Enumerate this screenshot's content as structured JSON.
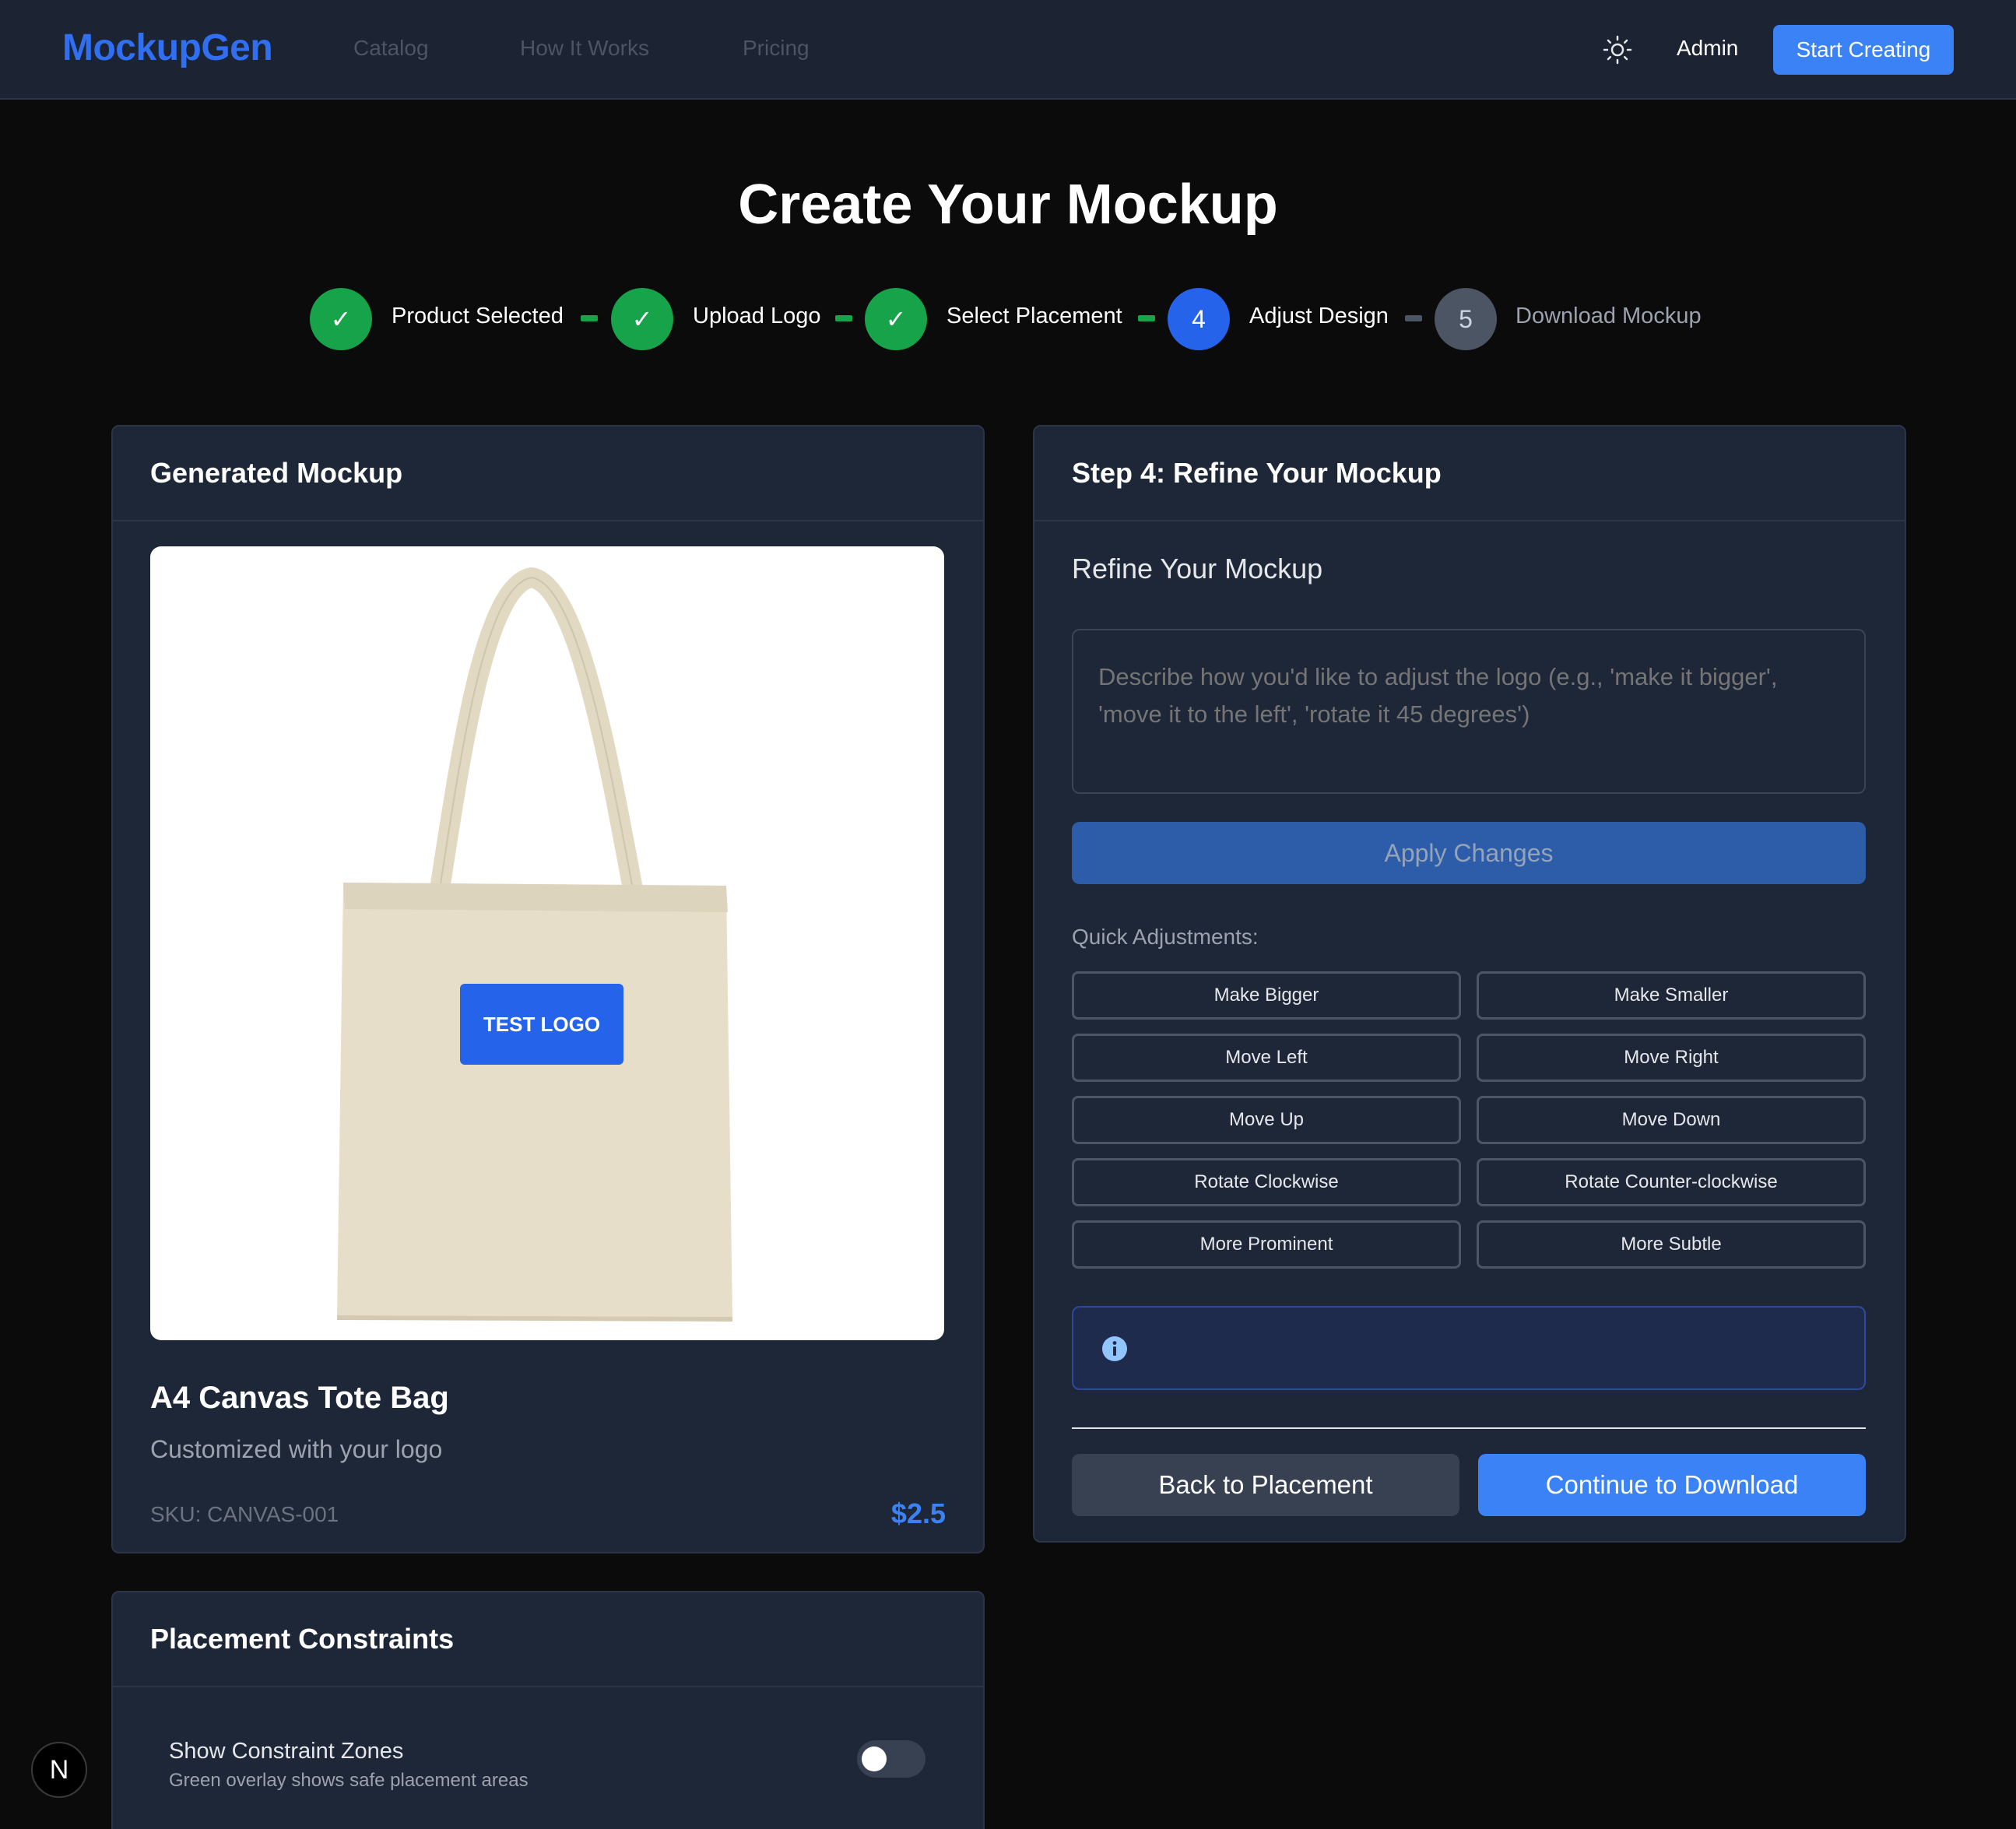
{
  "nav": {
    "brand": "MockupGen",
    "links": [
      "Catalog",
      "How It Works",
      "Pricing"
    ],
    "theme_icon": "sun-icon",
    "admin": "Admin",
    "cta": "Start Creating"
  },
  "page_title": "Create Your Mockup",
  "steps": [
    {
      "label": "Product Selected",
      "marker": "✓",
      "state": "done"
    },
    {
      "label": "Upload Logo",
      "marker": "✓",
      "state": "done"
    },
    {
      "label": "Select Placement",
      "marker": "✓",
      "state": "done"
    },
    {
      "label": "Adjust Design",
      "marker": "4",
      "state": "active"
    },
    {
      "label": "Download Mockup",
      "marker": "5",
      "state": "pending"
    }
  ],
  "mockup_card": {
    "title": "Generated Mockup",
    "logo_text": "TEST LOGO",
    "product_name": "A4 Canvas Tote Bag",
    "subtitle": "Customized with your logo",
    "sku": "SKU: CANVAS-001",
    "price": "$2.5"
  },
  "refine_card": {
    "title": "Step 4: Refine Your Mockup",
    "section_title": "Refine Your Mockup",
    "placeholder": "Describe how you'd like to adjust the logo (e.g., 'make it bigger', 'move it to the left', 'rotate it 45 degrees')",
    "apply": "Apply Changes",
    "quick_label": "Quick Adjustments:",
    "quick": [
      "Make Bigger",
      "Make Smaller",
      "Move Left",
      "Move Right",
      "Move Up",
      "Move Down",
      "Rotate Clockwise",
      "Rotate Counter-clockwise",
      "More Prominent",
      "More Subtle"
    ],
    "info_icon": "info-icon",
    "back": "Back to Placement",
    "continue": "Continue to Download"
  },
  "constraints_card": {
    "title": "Placement Constraints",
    "toggle_title": "Show Constraint Zones",
    "toggle_desc": "Green overlay shows safe placement areas",
    "toggle_on": false
  },
  "floating_badge": "N",
  "colors": {
    "accent": "#3b82f6",
    "done": "#16a34a",
    "card": "#1e2738",
    "page": "#0b0b0b"
  }
}
